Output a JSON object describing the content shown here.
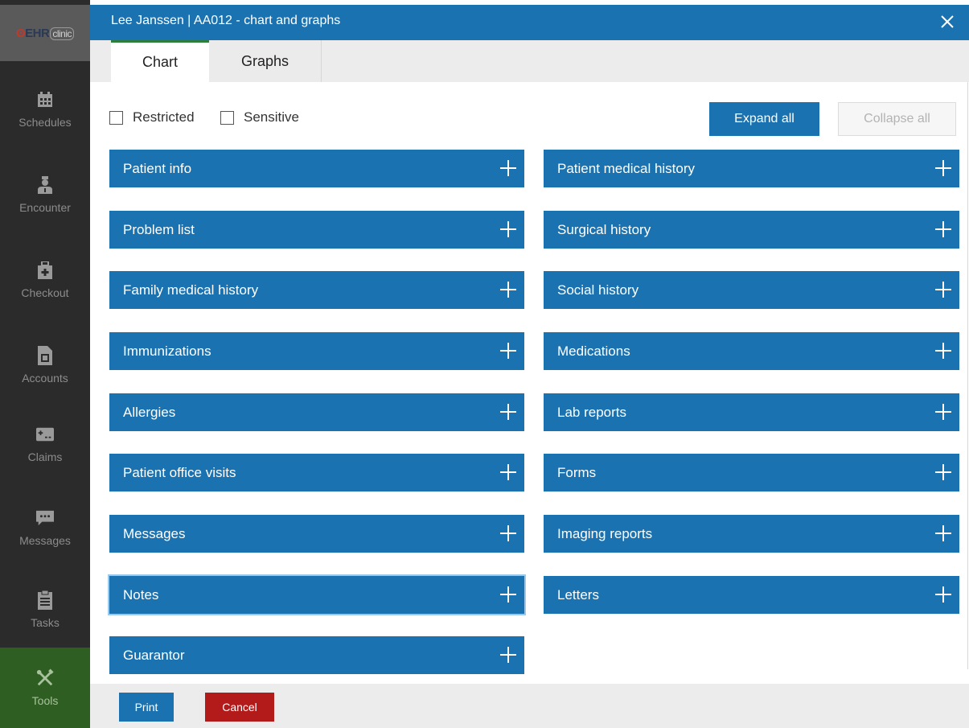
{
  "logo": {
    "brand": "EHR",
    "sub": "clinic"
  },
  "sidebar": {
    "items": [
      {
        "label": "Schedules",
        "icon": "calendar-icon"
      },
      {
        "label": "Encounter",
        "icon": "doctor-icon"
      },
      {
        "label": "Checkout",
        "icon": "medical-bag-icon"
      },
      {
        "label": "Accounts",
        "icon": "document-icon"
      },
      {
        "label": "Claims",
        "icon": "claims-card-icon"
      },
      {
        "label": "Messages",
        "icon": "chat-bubble-icon"
      },
      {
        "label": "Tasks",
        "icon": "clipboard-icon"
      },
      {
        "label": "Tools",
        "icon": "tools-icon"
      }
    ]
  },
  "header": {
    "title": "Lee Janssen | AA012 - chart and graphs"
  },
  "tabs": [
    {
      "label": "Chart"
    },
    {
      "label": "Graphs"
    }
  ],
  "filters": {
    "restricted": "Restricted",
    "sensitive": "Sensitive"
  },
  "actions": {
    "expand_all": "Expand all",
    "collapse_all": "Collapse all"
  },
  "sections": {
    "left": [
      {
        "label": "Patient info"
      },
      {
        "label": "Problem list"
      },
      {
        "label": "Family medical history"
      },
      {
        "label": "Immunizations"
      },
      {
        "label": "Allergies"
      },
      {
        "label": "Patient office visits"
      },
      {
        "label": "Messages"
      },
      {
        "label": "Notes"
      },
      {
        "label": "Guarantor"
      }
    ],
    "right": [
      {
        "label": "Patient medical history"
      },
      {
        "label": "Surgical history"
      },
      {
        "label": "Social history"
      },
      {
        "label": "Medications"
      },
      {
        "label": "Lab reports"
      },
      {
        "label": "Forms"
      },
      {
        "label": "Imaging reports"
      },
      {
        "label": "Letters"
      }
    ]
  },
  "footer": {
    "print": "Print",
    "cancel": "Cancel"
  },
  "colors": {
    "primary": "#1a73b0",
    "danger": "#b31b1b",
    "sidebar": "#2b2b2b",
    "tools_active": "#2e5e22",
    "active_tab_accent": "#2e7d3a"
  }
}
